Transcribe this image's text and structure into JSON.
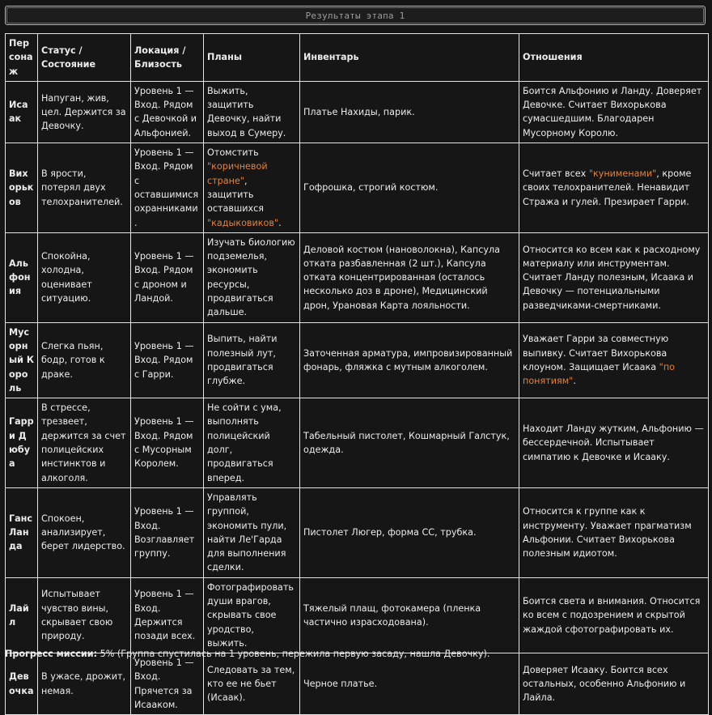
{
  "title": "Результаты этапа 1",
  "headers": {
    "character": "Персонаж",
    "status": "Статус / Состояние",
    "location": "Локация / Близость",
    "plans": "Планы",
    "inventory": "Инвентарь",
    "relations": "Отношения"
  },
  "rows": [
    {
      "name": "Исаак",
      "status": "Напуган, жив, цел. Держится за Девочку.",
      "location": "Уровень 1 — Вход. Рядом с Девочкой и Альфонией.",
      "plans": "Выжить, защитить Девочку, найти выход в Сумеру.",
      "inventory": "Платье Нахиды, парик.",
      "relations": "Боится Альфонию и Ланду. Доверяет Девочке. Считает Вихорькова сумасшедшим. Благодарен Мусорному Королю."
    },
    {
      "name": "Вихорьков",
      "status": "В ярости, потерял двух телохранителей.",
      "location": "Уровень 1 — Вход. Рядом с оставшимися охранниками.",
      "plans_a": "Отомстить ",
      "plans_h1": "\"коричневой стране\"",
      "plans_b": ", защитить оставшихся ",
      "plans_h2": "\"кадыковиков\"",
      "plans_c": ".",
      "inventory": "Гофрошка, строгий костюм.",
      "relations_a": "Считает всех ",
      "relations_h1": "\"кунименами\"",
      "relations_b": ", кроме своих телохранителей. Ненавидит Стража и гулей. Презирает Гарри."
    },
    {
      "name": "Альфония",
      "status": "Спокойна, холодна, оценивает ситуацию.",
      "location": "Уровень 1 — Вход. Рядом с дроном и Ландой.",
      "plans": "Изучать биологию подземелья, экономить ресурсы, продвигаться дальше.",
      "inventory": "Деловой костюм (нановолокна), Капсула отката разбавленная (2 шт.), Капсула отката концентрированная (осталось несколько доз в дроне), Медицинский дрон, Урановая Карта лояльности.",
      "relations": "Относится ко всем как к расходному материалу или инструментам. Считает Ланду полезным, Исаака и Девочку — потенциальными разведчиками-смертниками."
    },
    {
      "name": "Мусорный Король",
      "status": "Слегка пьян, бодр, готов к драке.",
      "location": "Уровень 1 — Вход. Рядом с Гарри.",
      "plans": "Выпить, найти полезный лут, продвигаться глубже.",
      "inventory": "Заточенная арматура, импровизированный фонарь, фляжка с мутным алкоголем.",
      "relations_a": "Уважает Гарри за совместную выпивку. Считает Вихорькова клоуном. Защищает Исаака ",
      "relations_h1": "\"по понятиям\"",
      "relations_b": "."
    },
    {
      "name": "Гарри Дюбуа",
      "status": "В стрессе, трезвеет, держится за счет полицейских инстинктов и алкоголя.",
      "location": "Уровень 1 — Вход. Рядом с Мусорным Королем.",
      "plans": "Не сойти с ума, выполнять полицейский долг, продвигаться вперед.",
      "inventory": "Табельный пистолет, Кошмарный Галстук, одежда.",
      "relations": "Находит Ланду жутким, Альфонию — бессердечной. Испытывает симпатию к Девочке и Исааку."
    },
    {
      "name": "Ганс Ланда",
      "status": "Спокоен, анализирует, берет лидерство.",
      "location": "Уровень 1 — Вход. Возглавляет группу.",
      "plans": "Управлять группой, экономить пули, найти Ле'Гарда для выполнения сделки.",
      "inventory": "Пистолет Люгер, форма СС, трубка.",
      "relations": "Относится к группе как к инструменту. Уважает прагматизм Альфонии. Считает Вихорькова полезным идиотом."
    },
    {
      "name": "Лайл",
      "status": "Испытывает чувство вины, скрывает свою природу.",
      "location": "Уровень 1 — Вход. Держится позади всех.",
      "plans": "Фотографировать души врагов, скрывать свое уродство, выжить.",
      "inventory": "Тяжелый плащ, фотокамера (пленка частично израсходована).",
      "relations": "Боится света и внимания. Относится ко всем с подозрением и скрытой жаждой сфотографировать их."
    },
    {
      "name": "Девочка",
      "status": "В ужасе, дрожит, немая.",
      "location": "Уровень 1 — Вход. Прячется за Исааком.",
      "plans": "Следовать за тем, кто ее не бьет (Исаак).",
      "inventory": "Черное платье.",
      "relations": "Доверяет Исааку. Боится всех остальных, особенно Альфонию и Лайла."
    }
  ],
  "progress": {
    "label": "Прогресс миссии:",
    "value": " 5%",
    "note": " (Группа спустилась на 1 уровень, пережила первую засаду, нашла Девочку)."
  }
}
